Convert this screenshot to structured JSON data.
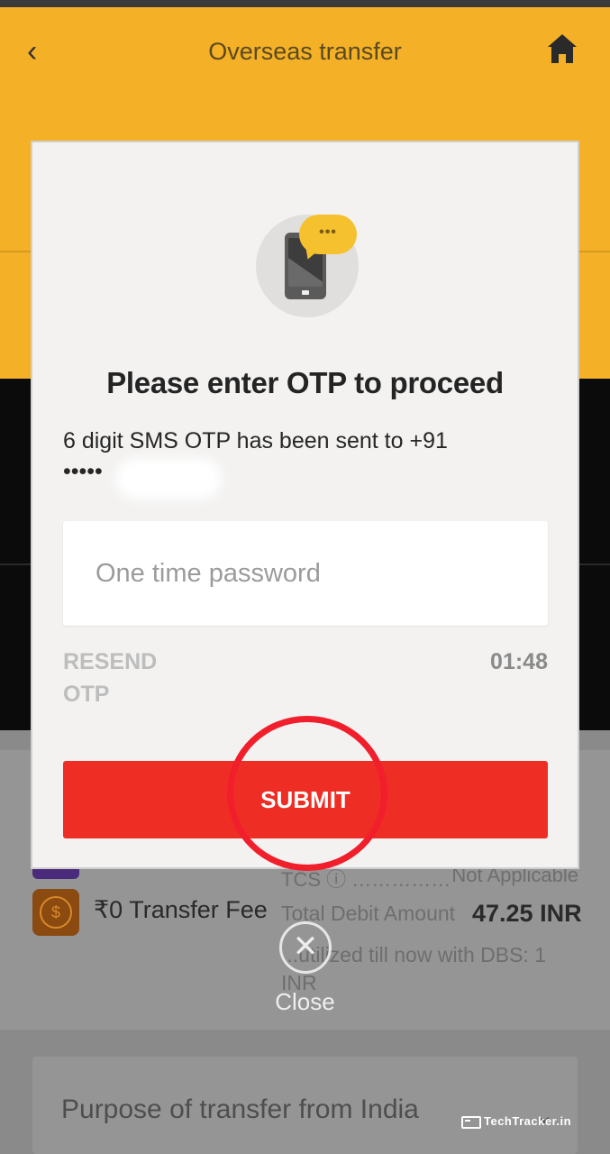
{
  "background": {
    "header_title": "Overseas transfer",
    "transfer_fee": "₹0 Transfer Fee",
    "tcs_label": "TCS",
    "tcs_value": "Not Applicable",
    "total_debit_label": "Total Debit Amount",
    "total_debit_amount": "47.25 INR",
    "utilized_text": "...utilized till now with DBS: 1 INR",
    "purpose_label": "Purpose of transfer from India",
    "icons": {
      "back": "back-arrow-icon",
      "home": "home-icon",
      "coin": "rupee-coin-icon",
      "chevron": "chevron-down-icon"
    }
  },
  "modal": {
    "illustration": "phone-sms-icon",
    "bubble_text": "•••",
    "title": "Please enter OTP to proceed",
    "sms_info": "6 digit SMS OTP has been sent to +91",
    "masked_number": "•••••",
    "otp_input": {
      "value": "",
      "placeholder": "One time password"
    },
    "resend_label": "RESEND OTP",
    "timer": "01:48",
    "submit_label": "SUBMIT"
  },
  "close": {
    "icon": "close-icon",
    "label": "Close"
  },
  "watermark": "TechTracker.in",
  "colors": {
    "submit_red": "#ee2e24",
    "highlight_ring": "#f01f2b",
    "brand_yellow": "#f4b026",
    "bubble_yellow": "#f6c12e"
  }
}
